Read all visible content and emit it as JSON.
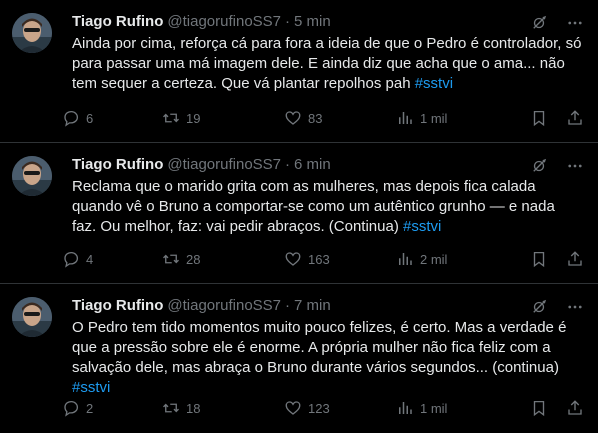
{
  "tweets": [
    {
      "author_name": "Tiago Rufino",
      "handle": "@tiagorufinoSS7",
      "separator": "·",
      "time": "5 min",
      "text": "Ainda por cima, reforça cá para fora a ideia de que o Pedro é controlador, só para passar uma má imagem dele. E ainda diz que acha que o ama... não tem sequer a certeza. Que vá plantar repolhos pah ",
      "hashtag": "#sstvi",
      "replies": "6",
      "retweets": "19",
      "likes": "83",
      "views": "1 mil"
    },
    {
      "author_name": "Tiago Rufino",
      "handle": "@tiagorufinoSS7",
      "separator": "·",
      "time": "6 min",
      "text": "Reclama que o marido grita com as mulheres, mas depois fica calada quando vê o Bruno a comportar-se como um autêntico grunho — e nada faz. Ou melhor, faz: vai pedir abraços. (Continua) ",
      "hashtag": "#sstvi",
      "replies": "4",
      "retweets": "28",
      "likes": "163",
      "views": "2 mil"
    },
    {
      "author_name": "Tiago Rufino",
      "handle": "@tiagorufinoSS7",
      "separator": "·",
      "time": "7 min",
      "text": "O Pedro tem tido momentos muito pouco felizes, é certo. Mas a verdade é que a pressão sobre ele é enorme. A própria mulher não fica feliz com a salvação dele, mas abraça o Bruno durante vários segundos... (continua)\n",
      "hashtag": "#sstvi",
      "replies": "2",
      "retweets": "18",
      "likes": "123",
      "views": "1 mil"
    }
  ],
  "icons": {
    "grok": "grok-icon",
    "more": "more-icon",
    "reply": "reply-icon",
    "retweet": "retweet-icon",
    "like": "like-icon",
    "views": "views-icon",
    "bookmark": "bookmark-icon",
    "share": "share-icon"
  },
  "colors": {
    "background": "#000000",
    "text": "#e7e9ea",
    "muted": "#71767b",
    "link": "#1d9bf0",
    "divider": "#2f3336"
  }
}
